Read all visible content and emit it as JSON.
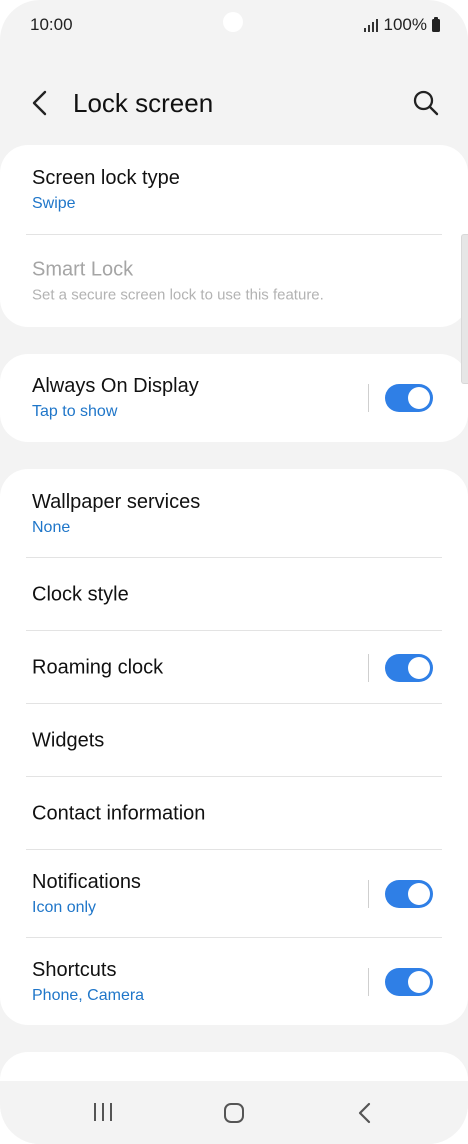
{
  "status_bar": {
    "time": "10:00",
    "battery": "100%",
    "icons": [
      "signal-icon",
      "battery-icon"
    ]
  },
  "header": {
    "title": "Lock screen",
    "back_icon": "chevron-left-icon",
    "search_icon": "search-icon"
  },
  "security": {
    "screen_lock_type": {
      "title": "Screen lock type",
      "value": "Swipe"
    },
    "smart_lock": {
      "title": "Smart Lock",
      "subtitle": "Set a secure screen lock to use this feature.",
      "enabled": false
    }
  },
  "display": {
    "always_on_display": {
      "title": "Always On Display",
      "subtitle": "Tap to show",
      "toggle": true
    }
  },
  "items": {
    "wallpaper_services": {
      "title": "Wallpaper services",
      "value": "None"
    },
    "clock_style": {
      "title": "Clock style"
    },
    "roaming_clock": {
      "title": "Roaming clock",
      "toggle": true
    },
    "widgets": {
      "title": "Widgets"
    },
    "contact_information": {
      "title": "Contact information"
    },
    "notifications": {
      "title": "Notifications",
      "value": "Icon only",
      "toggle": true
    },
    "shortcuts": {
      "title": "Shortcuts",
      "value": "Phone, Camera",
      "toggle": true
    }
  },
  "nav_bar": {
    "icons": [
      "recents-icon",
      "home-icon",
      "back-icon"
    ]
  },
  "colors": {
    "accent": "#2f7fe6",
    "subtitle_blue": "#1f76c9",
    "background": "#f3f3f3",
    "card": "#ffffff"
  }
}
